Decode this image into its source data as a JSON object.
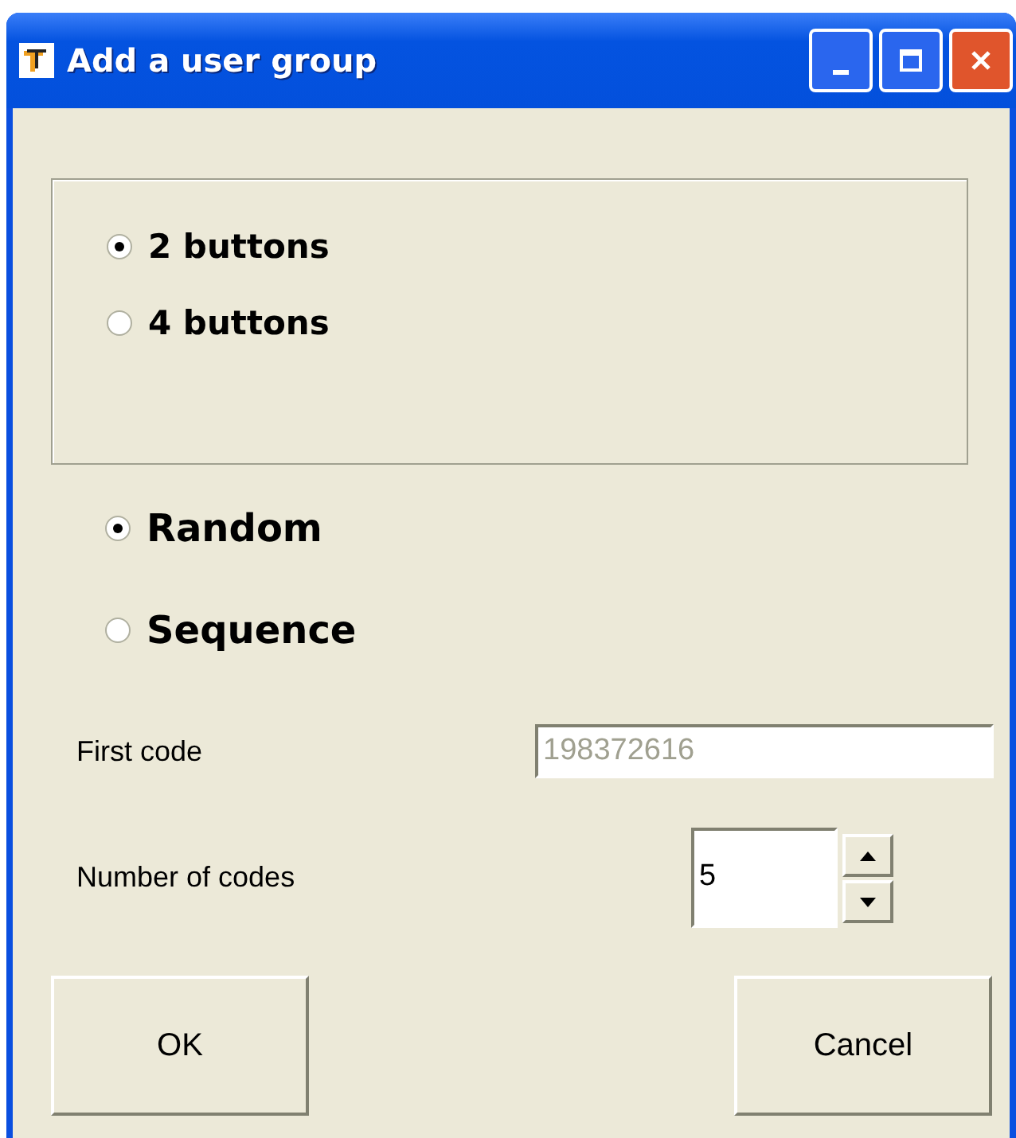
{
  "window": {
    "title": "Add a user group"
  },
  "button_count_options": [
    {
      "label": "2 buttons",
      "selected": true
    },
    {
      "label": "4 buttons",
      "selected": false
    }
  ],
  "code_mode_options": [
    {
      "label": "Random",
      "selected": true
    },
    {
      "label": "Sequence",
      "selected": false
    }
  ],
  "first_code": {
    "label": "First code",
    "value": "198372616",
    "disabled": true
  },
  "number_of_codes": {
    "label": "Number of codes",
    "value": "5"
  },
  "buttons": [
    {
      "label": "OK"
    },
    {
      "label": "Cancel"
    }
  ]
}
